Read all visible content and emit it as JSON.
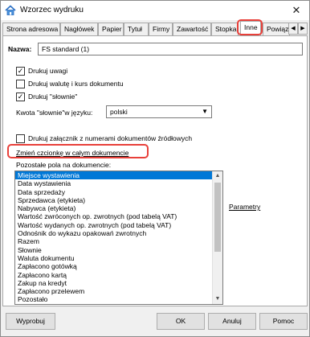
{
  "window": {
    "title": "Wzorzec wydruku",
    "close_glyph": "✕"
  },
  "tabs": [
    {
      "label": "Strona adresowa"
    },
    {
      "label": "Nagłówek"
    },
    {
      "label": "Papier"
    },
    {
      "label": "Tytuł"
    },
    {
      "label": "Firmy"
    },
    {
      "label": "Zawartość"
    },
    {
      "label": "Stopka"
    },
    {
      "label": "Inne",
      "active": true
    },
    {
      "label": "Powiąz"
    }
  ],
  "tab_scroll": {
    "left": "◀",
    "right": "▶"
  },
  "form": {
    "name_label": "Nazwa:",
    "name_value": "FS standard (1)",
    "checkboxes": [
      {
        "label": "Drukuj uwagi",
        "checked": true
      },
      {
        "label": "Drukuj walutę i kurs dokumentu",
        "checked": false
      },
      {
        "label": "Drukuj \"słownie\"",
        "checked": true
      }
    ],
    "language_label": "Kwota \"słownie\"w języku:",
    "language_value": "polski",
    "attachment_checkbox": {
      "label": "Drukuj załącznik z numerami dokumentów źródłowych",
      "checked": false
    },
    "change_font_link": "Zmień czcionkę w całym dokumencie",
    "other_fields_label": "Pozostałe pola na dokumencie:",
    "parameters_link": "Parametry"
  },
  "fields_list": [
    "Miejsce wystawienia",
    "Data wystawienia",
    "Data sprzedaży",
    "Sprzedawca (etykieta)",
    "Nabywca (etykieta)",
    "Wartość zwróconych op. zwrotnych (pod tabelą VAT)",
    "Wartość wydanych op. zwrotnych (pod tabelą VAT)",
    "Odnośnik do wykazu opakowań zwrotnych",
    "Razem",
    "Słownie",
    "Waluta dokumentu",
    "Zapłacono gotówką",
    "Zapłacono kartą",
    "Zakup na kredyt",
    "Zapłacono przelewem",
    "Pozostało"
  ],
  "fields_list_selected_index": 0,
  "buttons": {
    "print": "Wyprobuj",
    "ok": "OK",
    "cancel": "Anuluj",
    "help": "Pomoc"
  },
  "colors": {
    "highlight": "#e8403a",
    "selection": "#0078d7"
  }
}
